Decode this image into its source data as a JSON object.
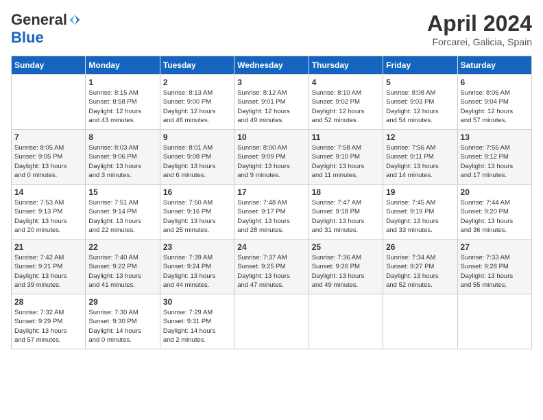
{
  "header": {
    "logo_general": "General",
    "logo_blue": "Blue",
    "title": "April 2024",
    "location": "Forcarei, Galicia, Spain"
  },
  "calendar": {
    "headers": [
      "Sunday",
      "Monday",
      "Tuesday",
      "Wednesday",
      "Thursday",
      "Friday",
      "Saturday"
    ],
    "weeks": [
      [
        {
          "day": "",
          "info": ""
        },
        {
          "day": "1",
          "info": "Sunrise: 8:15 AM\nSunset: 8:58 PM\nDaylight: 12 hours\nand 43 minutes."
        },
        {
          "day": "2",
          "info": "Sunrise: 8:13 AM\nSunset: 9:00 PM\nDaylight: 12 hours\nand 46 minutes."
        },
        {
          "day": "3",
          "info": "Sunrise: 8:12 AM\nSunset: 9:01 PM\nDaylight: 12 hours\nand 49 minutes."
        },
        {
          "day": "4",
          "info": "Sunrise: 8:10 AM\nSunset: 9:02 PM\nDaylight: 12 hours\nand 52 minutes."
        },
        {
          "day": "5",
          "info": "Sunrise: 8:08 AM\nSunset: 9:03 PM\nDaylight: 12 hours\nand 54 minutes."
        },
        {
          "day": "6",
          "info": "Sunrise: 8:06 AM\nSunset: 9:04 PM\nDaylight: 12 hours\nand 57 minutes."
        }
      ],
      [
        {
          "day": "7",
          "info": "Sunrise: 8:05 AM\nSunset: 9:05 PM\nDaylight: 13 hours\nand 0 minutes."
        },
        {
          "day": "8",
          "info": "Sunrise: 8:03 AM\nSunset: 9:06 PM\nDaylight: 13 hours\nand 3 minutes."
        },
        {
          "day": "9",
          "info": "Sunrise: 8:01 AM\nSunset: 9:08 PM\nDaylight: 13 hours\nand 6 minutes."
        },
        {
          "day": "10",
          "info": "Sunrise: 8:00 AM\nSunset: 9:09 PM\nDaylight: 13 hours\nand 9 minutes."
        },
        {
          "day": "11",
          "info": "Sunrise: 7:58 AM\nSunset: 9:10 PM\nDaylight: 13 hours\nand 11 minutes."
        },
        {
          "day": "12",
          "info": "Sunrise: 7:56 AM\nSunset: 9:11 PM\nDaylight: 13 hours\nand 14 minutes."
        },
        {
          "day": "13",
          "info": "Sunrise: 7:55 AM\nSunset: 9:12 PM\nDaylight: 13 hours\nand 17 minutes."
        }
      ],
      [
        {
          "day": "14",
          "info": "Sunrise: 7:53 AM\nSunset: 9:13 PM\nDaylight: 13 hours\nand 20 minutes."
        },
        {
          "day": "15",
          "info": "Sunrise: 7:51 AM\nSunset: 9:14 PM\nDaylight: 13 hours\nand 22 minutes."
        },
        {
          "day": "16",
          "info": "Sunrise: 7:50 AM\nSunset: 9:16 PM\nDaylight: 13 hours\nand 25 minutes."
        },
        {
          "day": "17",
          "info": "Sunrise: 7:48 AM\nSunset: 9:17 PM\nDaylight: 13 hours\nand 28 minutes."
        },
        {
          "day": "18",
          "info": "Sunrise: 7:47 AM\nSunset: 9:18 PM\nDaylight: 13 hours\nand 31 minutes."
        },
        {
          "day": "19",
          "info": "Sunrise: 7:45 AM\nSunset: 9:19 PM\nDaylight: 13 hours\nand 33 minutes."
        },
        {
          "day": "20",
          "info": "Sunrise: 7:44 AM\nSunset: 9:20 PM\nDaylight: 13 hours\nand 36 minutes."
        }
      ],
      [
        {
          "day": "21",
          "info": "Sunrise: 7:42 AM\nSunset: 9:21 PM\nDaylight: 13 hours\nand 39 minutes."
        },
        {
          "day": "22",
          "info": "Sunrise: 7:40 AM\nSunset: 9:22 PM\nDaylight: 13 hours\nand 41 minutes."
        },
        {
          "day": "23",
          "info": "Sunrise: 7:39 AM\nSunset: 9:24 PM\nDaylight: 13 hours\nand 44 minutes."
        },
        {
          "day": "24",
          "info": "Sunrise: 7:37 AM\nSunset: 9:25 PM\nDaylight: 13 hours\nand 47 minutes."
        },
        {
          "day": "25",
          "info": "Sunrise: 7:36 AM\nSunset: 9:26 PM\nDaylight: 13 hours\nand 49 minutes."
        },
        {
          "day": "26",
          "info": "Sunrise: 7:34 AM\nSunset: 9:27 PM\nDaylight: 13 hours\nand 52 minutes."
        },
        {
          "day": "27",
          "info": "Sunrise: 7:33 AM\nSunset: 9:28 PM\nDaylight: 13 hours\nand 55 minutes."
        }
      ],
      [
        {
          "day": "28",
          "info": "Sunrise: 7:32 AM\nSunset: 9:29 PM\nDaylight: 13 hours\nand 57 minutes."
        },
        {
          "day": "29",
          "info": "Sunrise: 7:30 AM\nSunset: 9:30 PM\nDaylight: 14 hours\nand 0 minutes."
        },
        {
          "day": "30",
          "info": "Sunrise: 7:29 AM\nSunset: 9:31 PM\nDaylight: 14 hours\nand 2 minutes."
        },
        {
          "day": "",
          "info": ""
        },
        {
          "day": "",
          "info": ""
        },
        {
          "day": "",
          "info": ""
        },
        {
          "day": "",
          "info": ""
        }
      ]
    ]
  }
}
